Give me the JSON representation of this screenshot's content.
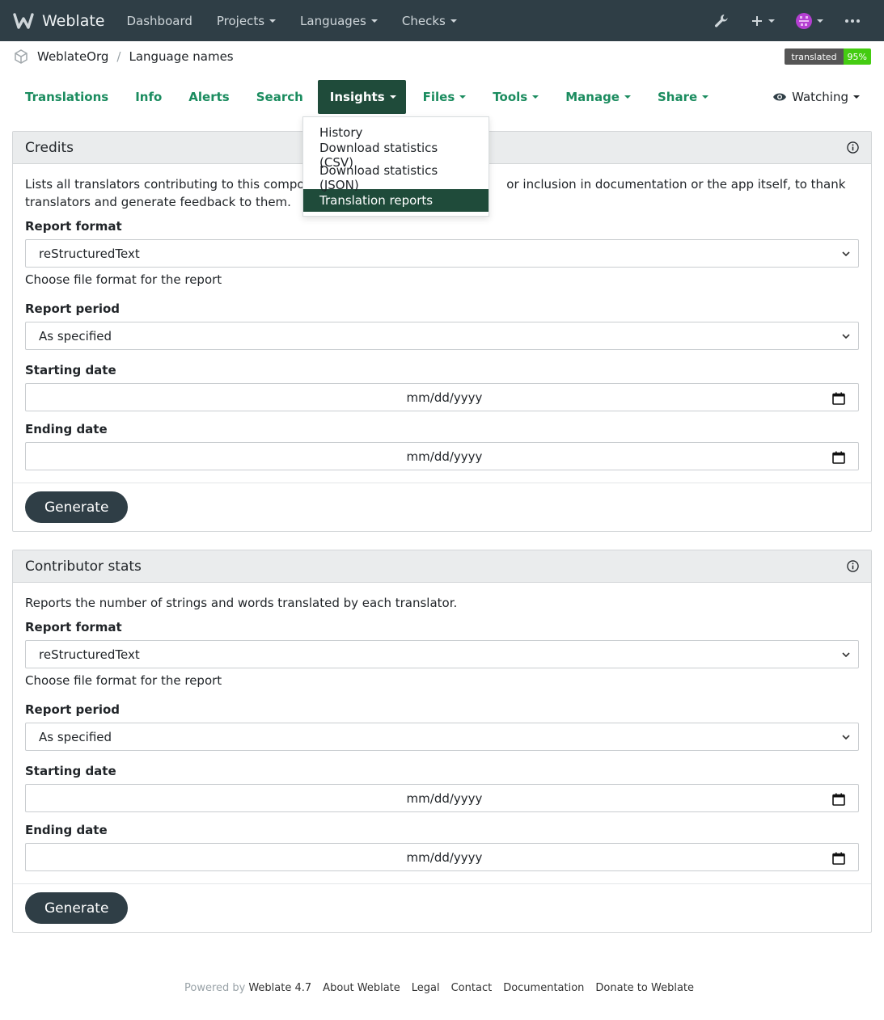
{
  "navbar": {
    "brand": "Weblate",
    "items": [
      {
        "label": "Dashboard"
      },
      {
        "label": "Projects"
      },
      {
        "label": "Languages"
      },
      {
        "label": "Checks"
      }
    ],
    "icons": [
      "wrench-icon",
      "plus-icon",
      "avatar",
      "more-icon"
    ]
  },
  "breadcrumb": {
    "project": "WeblateOrg",
    "separator": "/",
    "component": "Language names",
    "badge_label": "translated",
    "badge_value": "95%"
  },
  "tabs": [
    {
      "label": "Translations",
      "caret": false
    },
    {
      "label": "Info",
      "caret": false
    },
    {
      "label": "Alerts",
      "caret": false
    },
    {
      "label": "Search",
      "caret": false
    },
    {
      "label": "Insights",
      "caret": true
    },
    {
      "label": "Files",
      "caret": true
    },
    {
      "label": "Tools",
      "caret": true
    },
    {
      "label": "Manage",
      "caret": true
    },
    {
      "label": "Share",
      "caret": true
    }
  ],
  "watch_label": "Watching",
  "insights_menu": [
    {
      "label": "History"
    },
    {
      "label": "Download statistics (CSV)"
    },
    {
      "label": "Download statistics (JSON)"
    },
    {
      "label": "Translation reports"
    }
  ],
  "credits": {
    "title": "Credits",
    "description": "Lists all translators contributing to this component with their languages, for inclusion in documentation or the app itself, to thank translators and generate feedback to them.",
    "description_visible_a": "Lists all translators contributing to this compone",
    "description_visible_b": "or inclusion in documentation or the app itself, to thank",
    "description_visible_c": "translators and generate feedback to them.",
    "format_label": "Report format",
    "format_value": "reStructuredText",
    "format_help": "Choose file format for the report",
    "period_label": "Report period",
    "period_value": "As specified",
    "start_label": "Starting date",
    "start_placeholder": "mm/dd/yyyy",
    "end_label": "Ending date",
    "end_placeholder": "mm/dd/yyyy",
    "button": "Generate"
  },
  "contributor": {
    "title": "Contributor stats",
    "description": "Reports the number of strings and words translated by each translator.",
    "format_label": "Report format",
    "format_value": "reStructuredText",
    "format_help": "Choose file format for the report",
    "period_label": "Report period",
    "period_value": "As specified",
    "start_label": "Starting date",
    "start_placeholder": "mm/dd/yyyy",
    "end_label": "Ending date",
    "end_placeholder": "mm/dd/yyyy",
    "button": "Generate"
  },
  "footer": {
    "powered": "Powered by",
    "links": [
      "Weblate 4.7",
      "About Weblate",
      "Legal",
      "Contact",
      "Documentation",
      "Donate to Weblate"
    ]
  },
  "colors": {
    "navbar": "#2f3e46",
    "accent": "#1b8c5f",
    "active_tab": "#1f4b3a",
    "badge_green": "#44cc11"
  }
}
